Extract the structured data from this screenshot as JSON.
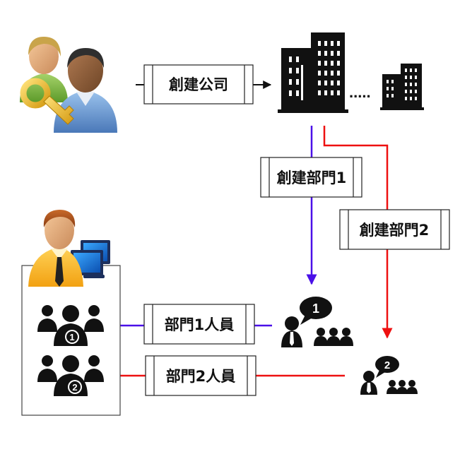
{
  "processes": {
    "create_company": "創建公司",
    "create_dept1": "創建部門1",
    "create_dept2": "創建部門2",
    "dept1_staff": "部門1人員",
    "dept2_staff": "部門2人員"
  },
  "ellipsis": ".....",
  "badges": {
    "dept1": "1",
    "dept2": "2",
    "group1": "1",
    "group2": "2"
  },
  "colors": {
    "blue_flow": "#4a10e8",
    "red_flow": "#ee1010",
    "black_flow": "#111111",
    "icon_black": "#111111"
  },
  "icons": {
    "admin": "admin-key-users-icon",
    "company_large": "office-building-icon",
    "company_small": "office-building-icon",
    "manager": "manager-computer-icon",
    "dept1_team": "team-chat-icon",
    "dept2_team": "team-chat-icon",
    "group1": "user-group-icon",
    "group2": "user-group-icon"
  }
}
